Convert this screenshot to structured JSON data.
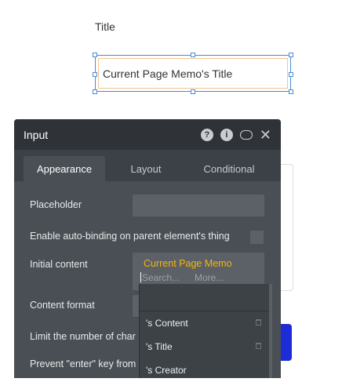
{
  "canvas": {
    "title_label": "Title",
    "input_value": "Current Page Memo's Title"
  },
  "panel": {
    "title": "Input",
    "icons": [
      "help-icon",
      "info-icon",
      "comment-icon",
      "close-icon"
    ],
    "tabs": [
      {
        "label": "Appearance",
        "active": true
      },
      {
        "label": "Layout",
        "active": false
      },
      {
        "label": "Conditional",
        "active": false
      }
    ],
    "rows": {
      "placeholder_label": "Placeholder",
      "placeholder_value": "",
      "autobind_label": "Enable auto-binding on parent element's thing",
      "initial_content_label": "Initial content",
      "content_format_label": "Content format",
      "limit_label": "Limit the number of char",
      "prevent_enter_label": "Prevent \"enter\" key from"
    },
    "expression": {
      "value": "Current Page Memo",
      "search_placeholder": "Search...",
      "more_label": "More..."
    },
    "dropdown": {
      "items": [
        "'s Content",
        "'s Title",
        "'s Creator"
      ]
    }
  },
  "colors": {
    "panel_bg": "#4a4f55",
    "header_bg": "#2f3338",
    "expression": "#f5b50a",
    "selection": "#4a8ad8",
    "primary_button": "#1c2cd6"
  }
}
